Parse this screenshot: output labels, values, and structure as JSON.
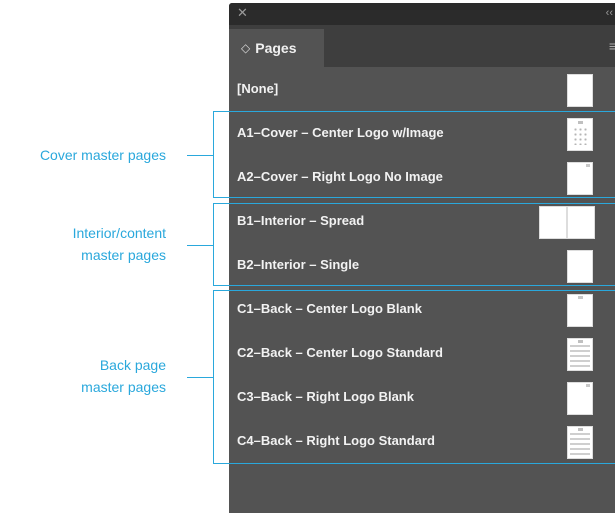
{
  "panel": {
    "close_glyph": "✕",
    "collapse_glyph": "‹‹",
    "tab_arrows_glyph": "◇",
    "tab_label": "Pages",
    "menu_glyph": "≡"
  },
  "rows": [
    {
      "label": "[None]",
      "thumb": "blank"
    },
    {
      "label": "A1–Cover – Center Logo w/Image",
      "thumb": "image"
    },
    {
      "label": "A2–Cover – Right Logo No Image",
      "thumb": "small-logo-right"
    },
    {
      "label": "B1–Interior – Spread",
      "thumb": "spread"
    },
    {
      "label": "B2–Interior – Single",
      "thumb": "blank"
    },
    {
      "label": "C1–Back – Center Logo Blank",
      "thumb": "small-logo-center"
    },
    {
      "label": "C2–Back – Center Logo Standard",
      "thumb": "standard"
    },
    {
      "label": "C3–Back – Right Logo Blank",
      "thumb": "small-logo-right"
    },
    {
      "label": "C4–Back – Right Logo Standard",
      "thumb": "standard"
    }
  ],
  "annotations": {
    "cover": {
      "line1": "Cover master pages"
    },
    "interior": {
      "line1": "Interior/content",
      "line2": "master pages"
    },
    "back": {
      "line1": "Back page",
      "line2": "master pages"
    }
  },
  "colors": {
    "panel_bg": "#535353",
    "title_strip": "#2b2b2b",
    "tab_bar": "#3e3e3e",
    "annotation_accent": "#2aa8dc",
    "row_text": "#f2f2f2"
  }
}
